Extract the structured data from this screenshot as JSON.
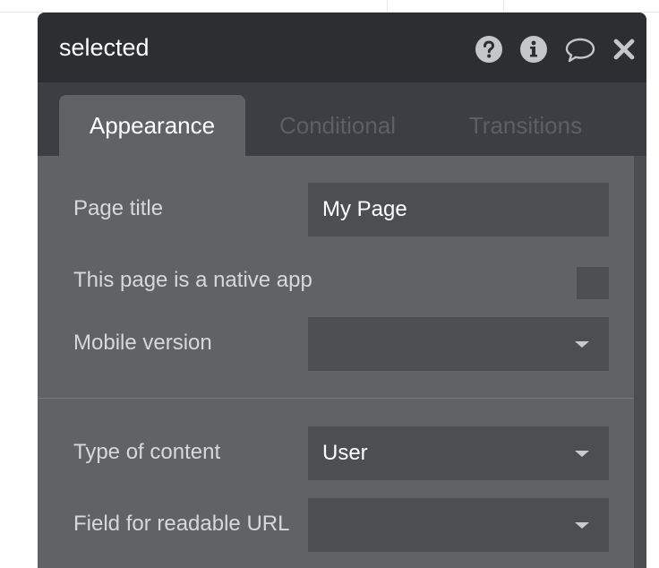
{
  "panel": {
    "title": "selected",
    "icons": [
      "question-icon",
      "info-icon",
      "comment-icon",
      "close-icon"
    ]
  },
  "tabs": [
    {
      "label": "Appearance",
      "active": true
    },
    {
      "label": "Conditional",
      "active": false
    },
    {
      "label": "Transitions",
      "active": false
    }
  ],
  "fields": {
    "page_title": {
      "label": "Page title",
      "value": "My Page"
    },
    "native_app": {
      "label": "This page is a native app",
      "checked": false
    },
    "mobile_version": {
      "label": "Mobile version",
      "value": ""
    },
    "type_of_content": {
      "label": "Type of content",
      "value": "User"
    },
    "readable_url": {
      "label": "Field for readable URL",
      "value": ""
    }
  },
  "colors": {
    "titlebar": "#2b2f32",
    "tabbar": "#3b3f43",
    "panel_bg": "#5f6366",
    "field_bg": "#4b4f52",
    "text_light": "#d6d8da"
  }
}
